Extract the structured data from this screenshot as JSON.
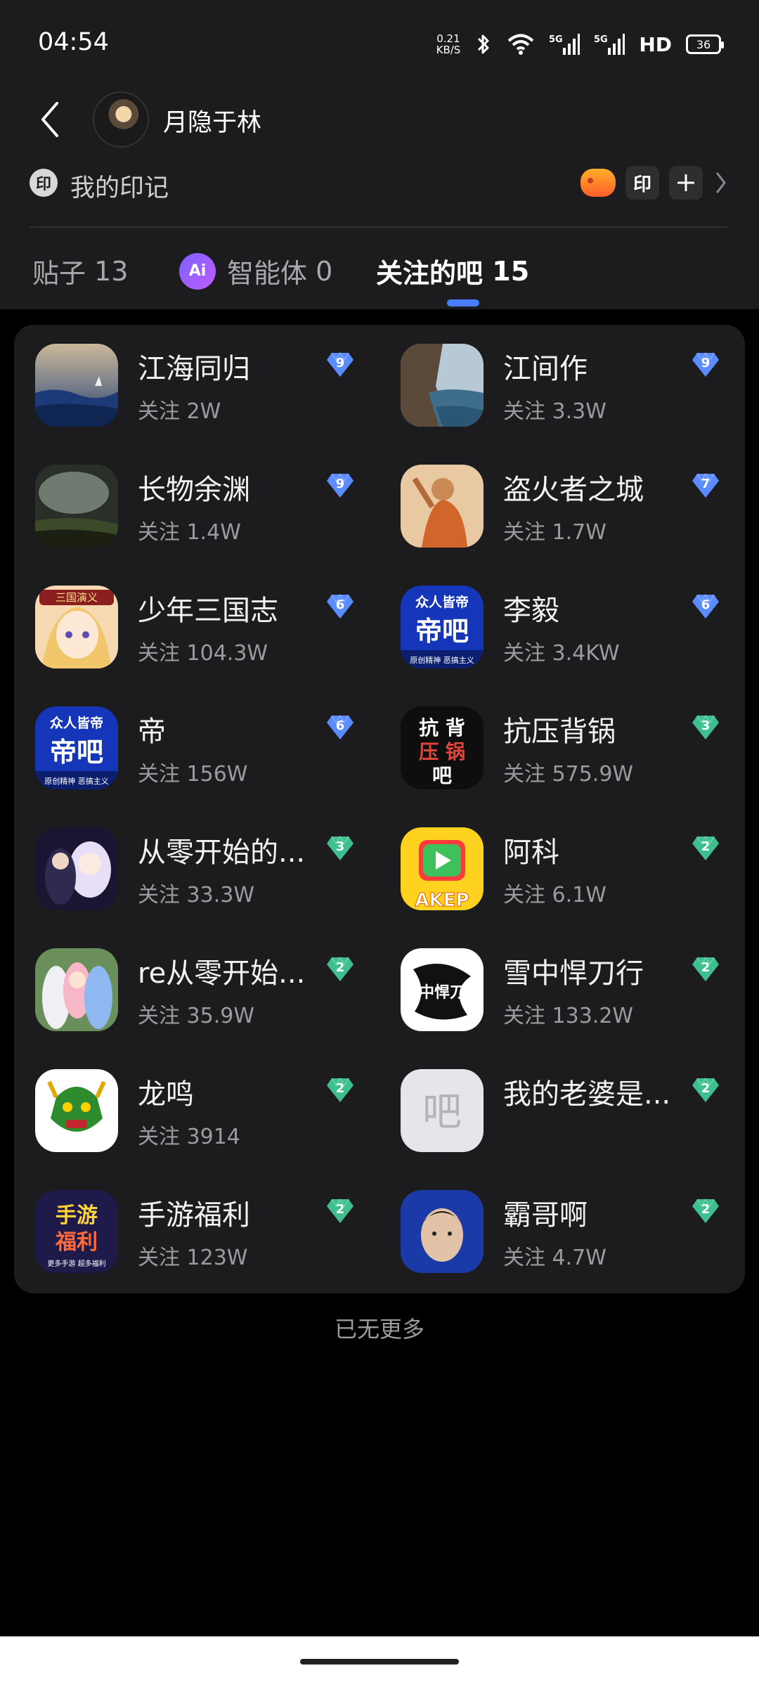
{
  "status_bar": {
    "time": "04:54",
    "net_speed_value": "0.21",
    "net_speed_unit": "KB/S",
    "hd_label": "HD",
    "battery": "36"
  },
  "profile": {
    "username": "月隐于林",
    "mark_label": "我的印记",
    "mark_icon_text": "印",
    "seal_button_text": "印"
  },
  "tabs": [
    {
      "label": "贴子",
      "count": "13"
    },
    {
      "label": "智能体",
      "count": "0",
      "badge_text": "Ai"
    },
    {
      "label": "关注的吧",
      "count": "15",
      "active": true
    }
  ],
  "bars": [
    {
      "name": "江海同归",
      "follow": "关注 2W",
      "level": "9",
      "thumb": "painting-sea"
    },
    {
      "name": "江间作",
      "follow": "关注 3.3W",
      "level": "9",
      "thumb": "painting-cliff"
    },
    {
      "name": "长物余渊",
      "follow": "关注 1.4W",
      "level": "9",
      "thumb": "painting-storm"
    },
    {
      "name": "盗火者之城",
      "follow": "关注 1.7W",
      "level": "7",
      "thumb": "painting-figure"
    },
    {
      "name": "少年三国志",
      "follow": "关注 104.3W",
      "level": "6",
      "thumb": "anime-girl"
    },
    {
      "name": "李毅",
      "follow": "关注 3.4KW",
      "level": "6",
      "thumb": "diba-logo"
    },
    {
      "name": "帝",
      "follow": "关注 156W",
      "level": "6",
      "thumb": "diba-logo"
    },
    {
      "name": "抗压背锅",
      "follow": "关注 575.9W",
      "level": "3",
      "thumb": "dark-logo"
    },
    {
      "name": "从零开始的...",
      "follow": "关注 33.3W",
      "level": "3",
      "thumb": "anime-group"
    },
    {
      "name": "阿科",
      "follow": "关注 6.1W",
      "level": "2",
      "thumb": "play-logo"
    },
    {
      "name": "re从零开始...",
      "follow": "关注 35.9W",
      "level": "2",
      "thumb": "anime-trio"
    },
    {
      "name": "雪中悍刀行",
      "follow": "关注 133.2W",
      "level": "2",
      "thumb": "calligraphy"
    },
    {
      "name": "龙鸣",
      "follow": "关注 3914",
      "level": "2",
      "thumb": "dragon-head"
    },
    {
      "name": "我的老婆是...",
      "follow": "",
      "level": "2",
      "thumb": "placeholder-ba",
      "placeholder_char": "吧"
    },
    {
      "name": "手游福利",
      "follow": "关注 123W",
      "level": "2",
      "thumb": "game-welfare"
    },
    {
      "name": "霸哥啊",
      "follow": "关注 4.7W",
      "level": "2",
      "thumb": "portrait-blue"
    }
  ],
  "thumb_text": {
    "diba_top": "众人皆帝",
    "diba_mid": "帝吧",
    "diba_bottom": "原创精神 恶搞主义",
    "anime_top": "三国演义",
    "dark_top": "抗 背",
    "dark_mid": "压 锅",
    "dark_bottom": "吧",
    "play_bottom": "AKEP",
    "welfare_top": "手游",
    "welfare_mid": "福利",
    "welfare_bottom": "更多手游 超多福利",
    "calligraphy_chars": "雪中悍刀行"
  },
  "level_colors": {
    "blue": "#5b8cff",
    "green": "#3fbf8f"
  },
  "footer": {
    "end_text": "已无更多"
  }
}
